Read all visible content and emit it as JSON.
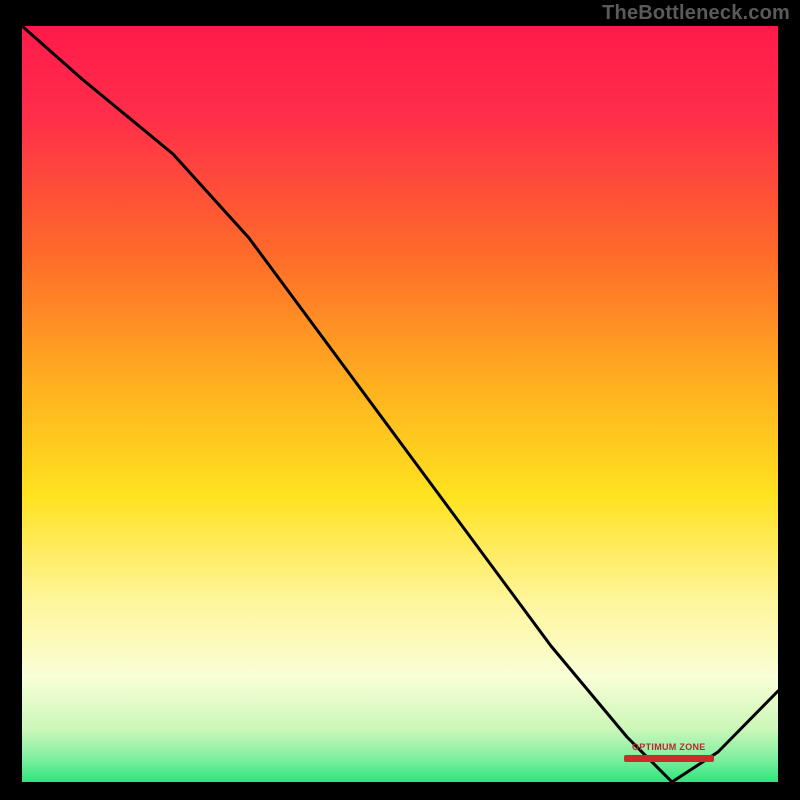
{
  "watermark": {
    "text": "TheBottleneck.com"
  },
  "marker": {
    "label": "OPTIMUM ZONE"
  },
  "colors": {
    "black": "#000000",
    "grad_top": "#ff1a4b",
    "grad_mid1": "#ff7a1f",
    "grad_mid2": "#ffd21f",
    "grad_mid3": "#fff59b",
    "grad_mid4": "#f6ffd1",
    "grad_bottom": "#2ee57c",
    "line": "#000000",
    "marker": "#b8292f"
  },
  "chart_data": {
    "type": "line",
    "xlabel": "",
    "ylabel": "",
    "xlim": [
      0,
      100
    ],
    "ylim": [
      0,
      100
    ],
    "grid": false,
    "gradient_stops": [
      {
        "pos": 0.0,
        "color": "#ff1a4b"
      },
      {
        "pos": 0.3,
        "color": "#ff5a2a"
      },
      {
        "pos": 0.55,
        "color": "#ffd21f"
      },
      {
        "pos": 0.77,
        "color": "#fff59b"
      },
      {
        "pos": 0.9,
        "color": "#f6ffd1"
      },
      {
        "pos": 1.0,
        "color": "#2ee57c"
      }
    ],
    "series": [
      {
        "name": "bottleneck-curve",
        "x": [
          0,
          8,
          20,
          30,
          50,
          70,
          80,
          86,
          92,
          100
        ],
        "y": [
          100,
          93,
          83,
          72,
          45,
          18,
          6,
          0,
          4,
          12
        ]
      }
    ],
    "annotations": [
      {
        "text": "OPTIMUM ZONE",
        "x": 84,
        "y": 3
      }
    ]
  }
}
